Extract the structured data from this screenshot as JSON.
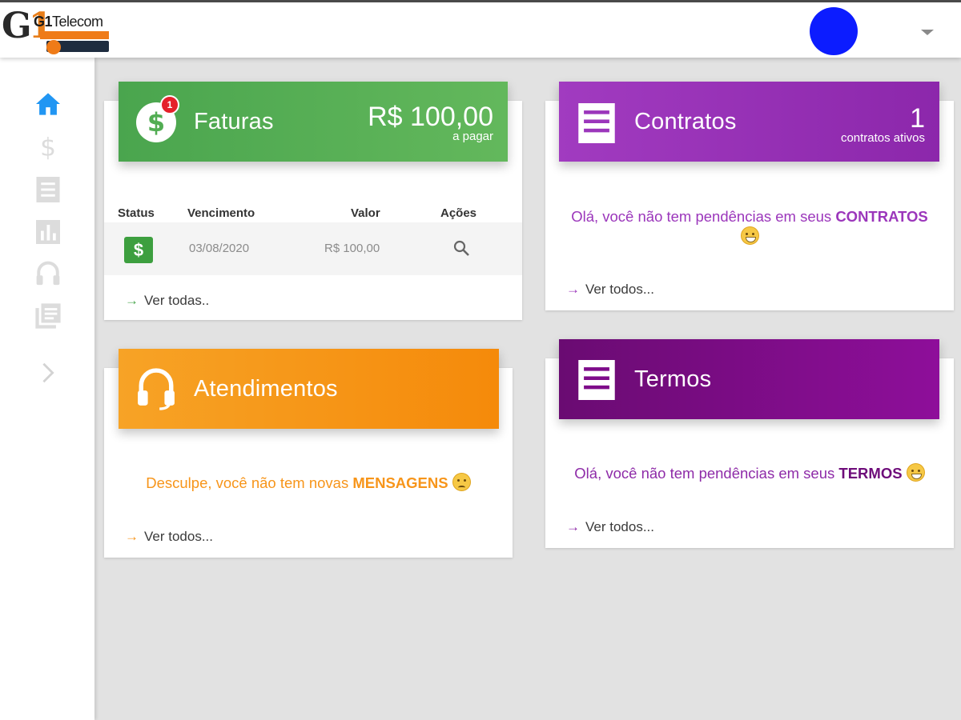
{
  "header": {
    "logo": {
      "brand": "G1",
      "name_bold": "G1",
      "name_rest": "Telecom"
    }
  },
  "colors": {
    "faturas": "#5bb25b",
    "contratos": "#9b36bb",
    "atendimentos": "#f7951a",
    "termos": "#7e0c8a",
    "sidebar_active": "#2196f3",
    "sidebar_inactive": "#dcdcdc",
    "avatar": "#0c1cff"
  },
  "sidebar": {
    "items": [
      {
        "icon": "home-icon",
        "active": true
      },
      {
        "icon": "dollar-icon",
        "active": false
      },
      {
        "icon": "receipt-icon",
        "active": false
      },
      {
        "icon": "bar-chart-icon",
        "active": false
      },
      {
        "icon": "headset-icon",
        "active": false
      },
      {
        "icon": "library-books-icon",
        "active": false
      },
      {
        "icon": "chevron-right-icon",
        "active": false
      }
    ]
  },
  "faturas": {
    "title": "Faturas",
    "badge": "1",
    "amount": "R$ 100,00",
    "amount_caption": "a pagar",
    "columns": [
      "Status",
      "Vencimento",
      "Valor",
      "Ações"
    ],
    "rows": [
      {
        "status_icon": "$",
        "vencimento": "03/08/2020",
        "valor": "R$ 100,00"
      }
    ],
    "link": "Ver todas.."
  },
  "contratos": {
    "title": "Contratos",
    "count": "1",
    "count_caption": "contratos ativos",
    "message_prefix": "Olá, você não tem pendências em seus ",
    "message_strong": "CONTRATOS",
    "link": "Ver todos..."
  },
  "atendimentos": {
    "title": "Atendimentos",
    "message_prefix": "Desculpe, você não tem novas ",
    "message_strong": "MENSAGENS",
    "link": "Ver todos..."
  },
  "termos": {
    "title": "Termos",
    "message_prefix": "Olá, você não tem pendências em seus ",
    "message_strong": "TERMOS",
    "link": "Ver todos..."
  }
}
